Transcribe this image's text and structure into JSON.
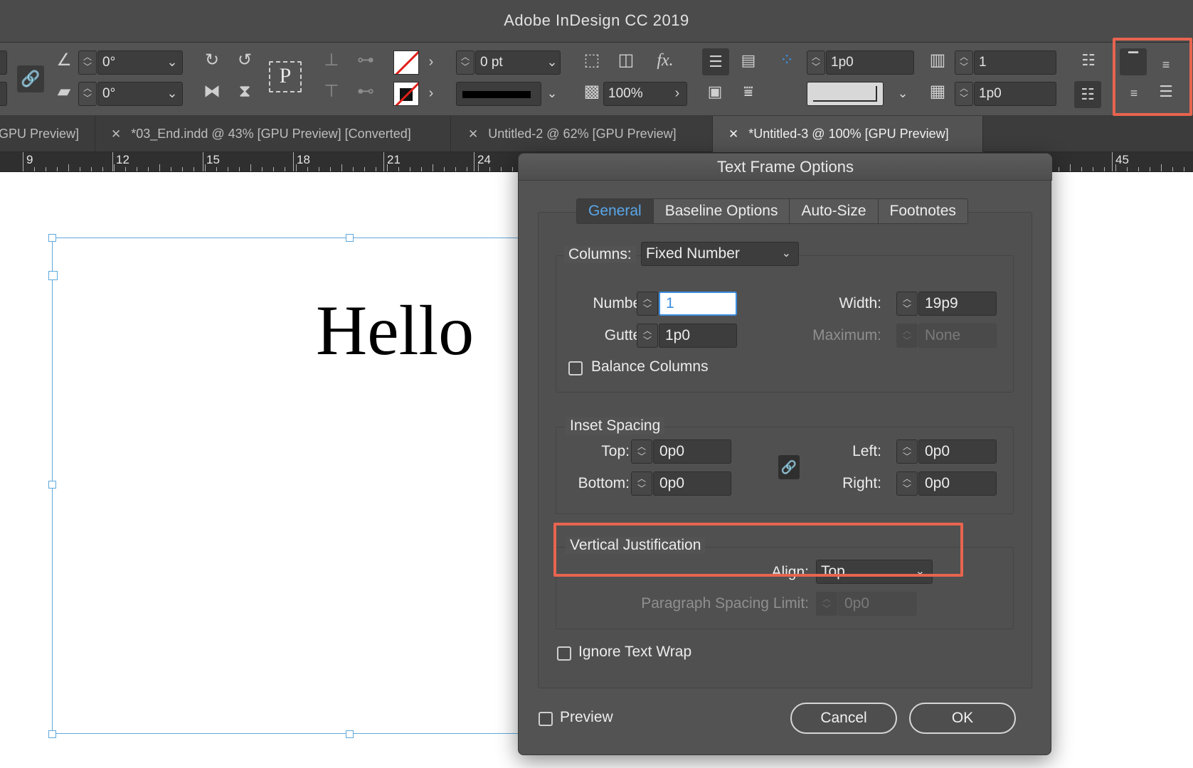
{
  "app": {
    "title": "Adobe InDesign CC 2019"
  },
  "control_panel": {
    "rotate_angle": "0°",
    "shear_angle": "0°",
    "stroke_weight": "0 pt",
    "opacity": "100%",
    "text_frame_inset": "1p0",
    "columns_count": "1",
    "gutter": "1p0",
    "proxy_letter": "P",
    "fx_label": "fx."
  },
  "document_tabs": [
    {
      "label": "GPU Preview]",
      "active": false
    },
    {
      "label": "*03_End.indd @ 43% [GPU Preview] [Converted]",
      "active": false
    },
    {
      "label": "Untitled-2 @ 62% [GPU Preview]",
      "active": false
    },
    {
      "label": "*Untitled-3 @ 100% [GPU Preview]",
      "active": true
    }
  ],
  "ruler": {
    "labels": [
      "9",
      "12",
      "15",
      "18",
      "21",
      "24",
      "45"
    ]
  },
  "canvas": {
    "frame_text": "Hello"
  },
  "dialog": {
    "title": "Text Frame Options",
    "tabs": [
      "General",
      "Baseline Options",
      "Auto-Size",
      "Footnotes"
    ],
    "active_tab": "General",
    "columns": {
      "label": "Columns:",
      "mode": "Fixed Number",
      "number_label": "Number:",
      "number_value": "1",
      "width_label": "Width:",
      "width_value": "19p9",
      "gutter_label": "Gutter:",
      "gutter_value": "1p0",
      "maximum_label": "Maximum:",
      "maximum_value": "None",
      "balance_label": "Balance Columns",
      "balance_checked": false
    },
    "inset_spacing": {
      "title": "Inset Spacing",
      "top_label": "Top:",
      "top_value": "0p0",
      "bottom_label": "Bottom:",
      "bottom_value": "0p0",
      "left_label": "Left:",
      "left_value": "0p0",
      "right_label": "Right:",
      "right_value": "0p0"
    },
    "vertical_justification": {
      "title": "Vertical Justification",
      "align_label": "Align:",
      "align_value": "Top",
      "para_spacing_label": "Paragraph Spacing Limit:",
      "para_spacing_value": "0p0"
    },
    "ignore_wrap_label": "Ignore Text Wrap",
    "preview_label": "Preview",
    "cancel_label": "Cancel",
    "ok_label": "OK"
  },
  "colors": {
    "highlight": "#e8644f",
    "active_tab_text": "#59a7ea",
    "selection": "#5fa8db"
  }
}
